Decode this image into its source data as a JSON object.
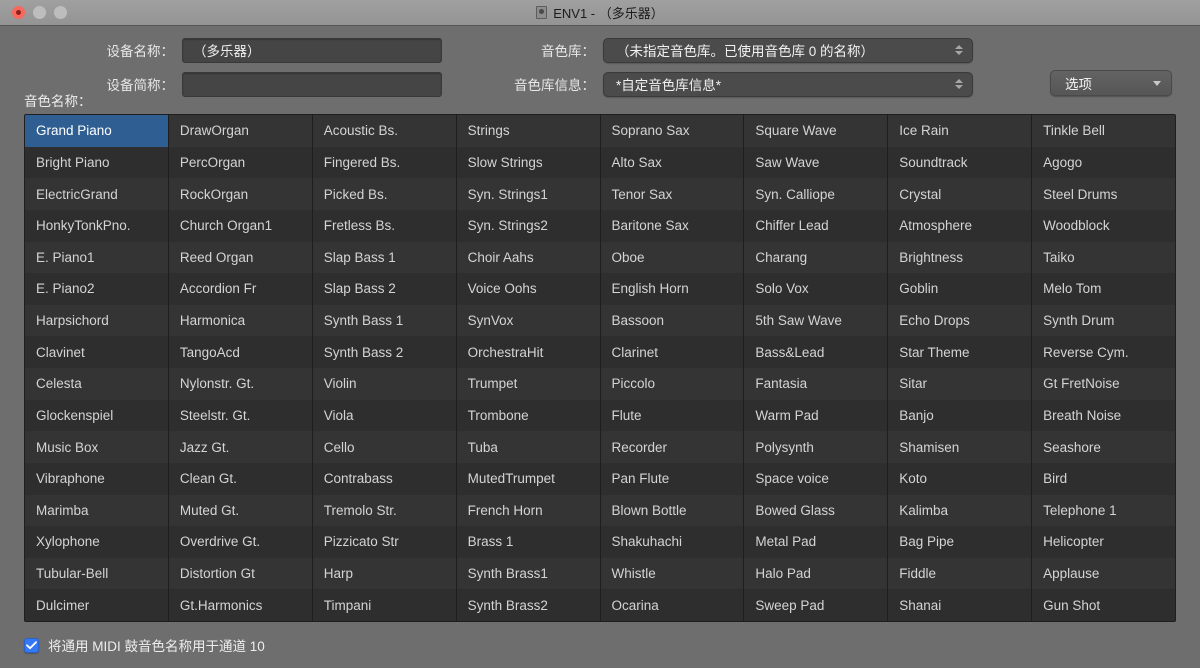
{
  "window": {
    "title": "ENV1 - （多乐器）",
    "doc_icon": "device-icon",
    "traffic": {
      "close": "close-button",
      "minimize": "minimize-button",
      "maximize": "maximize-button"
    }
  },
  "header": {
    "device_name_label": "设备名称：",
    "device_name_value": "（多乐器）",
    "device_short_label": "设备简称：",
    "device_short_value": "",
    "bank_label": "音色库：",
    "bank_value": "（未指定音色库。已使用音色库 0 的名称）",
    "bank_info_label": "音色库信息：",
    "bank_info_value": "*自定音色库信息*",
    "options_label": "选项"
  },
  "list": {
    "label": "音色名称：",
    "selected": "Grand Piano",
    "columns": [
      [
        "Grand Piano",
        "Bright Piano",
        "ElectricGrand",
        "HonkyTonkPno.",
        "E. Piano1",
        "E. Piano2",
        "Harpsichord",
        "Clavinet",
        "Celesta",
        "Glockenspiel",
        "Music Box",
        "Vibraphone",
        "Marimba",
        "Xylophone",
        "Tubular-Bell",
        "Dulcimer"
      ],
      [
        "DrawOrgan",
        "PercOrgan",
        "RockOrgan",
        "Church Organ1",
        "Reed Organ",
        "Accordion Fr",
        "Harmonica",
        "TangoAcd",
        "Nylonstr. Gt.",
        "Steelstr. Gt.",
        "Jazz Gt.",
        "Clean Gt.",
        "Muted Gt.",
        "Overdrive Gt.",
        "Distortion Gt",
        "Gt.Harmonics"
      ],
      [
        "Acoustic Bs.",
        "Fingered Bs.",
        "Picked Bs.",
        "Fretless Bs.",
        "Slap Bass 1",
        "Slap Bass 2",
        "Synth Bass 1",
        "Synth Bass 2",
        "Violin",
        "Viola",
        "Cello",
        "Contrabass",
        "Tremolo Str.",
        "Pizzicato Str",
        "Harp",
        "Timpani"
      ],
      [
        "Strings",
        "Slow Strings",
        "Syn. Strings1",
        "Syn. Strings2",
        "Choir Aahs",
        "Voice Oohs",
        "SynVox",
        "OrchestraHit",
        "Trumpet",
        "Trombone",
        "Tuba",
        "MutedTrumpet",
        "French Horn",
        "Brass 1",
        "Synth Brass1",
        "Synth Brass2"
      ],
      [
        "Soprano Sax",
        "Alto Sax",
        "Tenor Sax",
        "Baritone Sax",
        "Oboe",
        "English Horn",
        "Bassoon",
        "Clarinet",
        "Piccolo",
        "Flute",
        "Recorder",
        "Pan Flute",
        "Blown Bottle",
        "Shakuhachi",
        "Whistle",
        "Ocarina"
      ],
      [
        "Square Wave",
        "Saw Wave",
        "Syn. Calliope",
        "Chiffer Lead",
        "Charang",
        "Solo Vox",
        "5th Saw Wave",
        "Bass&Lead",
        "Fantasia",
        "Warm Pad",
        "Polysynth",
        "Space voice",
        "Bowed Glass",
        "Metal Pad",
        "Halo Pad",
        "Sweep Pad"
      ],
      [
        "Ice Rain",
        "Soundtrack",
        "Crystal",
        "Atmosphere",
        "Brightness",
        "Goblin",
        "Echo Drops",
        "Star Theme",
        "Sitar",
        "Banjo",
        "Shamisen",
        "Koto",
        "Kalimba",
        "Bag Pipe",
        "Fiddle",
        "Shanai"
      ],
      [
        "Tinkle Bell",
        "Agogo",
        "Steel Drums",
        "Woodblock",
        "Taiko",
        "Melo Tom",
        "Synth Drum",
        "Reverse Cym.",
        "Gt FretNoise",
        "Breath Noise",
        "Seashore",
        "Bird",
        "Telephone 1",
        "Helicopter",
        "Applause",
        "Gun Shot"
      ]
    ]
  },
  "footer": {
    "checkbox_label": "将通用 MIDI 鼓音色名称用于通道 10",
    "checkbox_checked": true
  },
  "colors": {
    "accent_blue": "#3478f6",
    "selection_blue": "#2e5e92",
    "window_bg": "#6e6e6e",
    "list_bg": "#2c2c2c"
  }
}
